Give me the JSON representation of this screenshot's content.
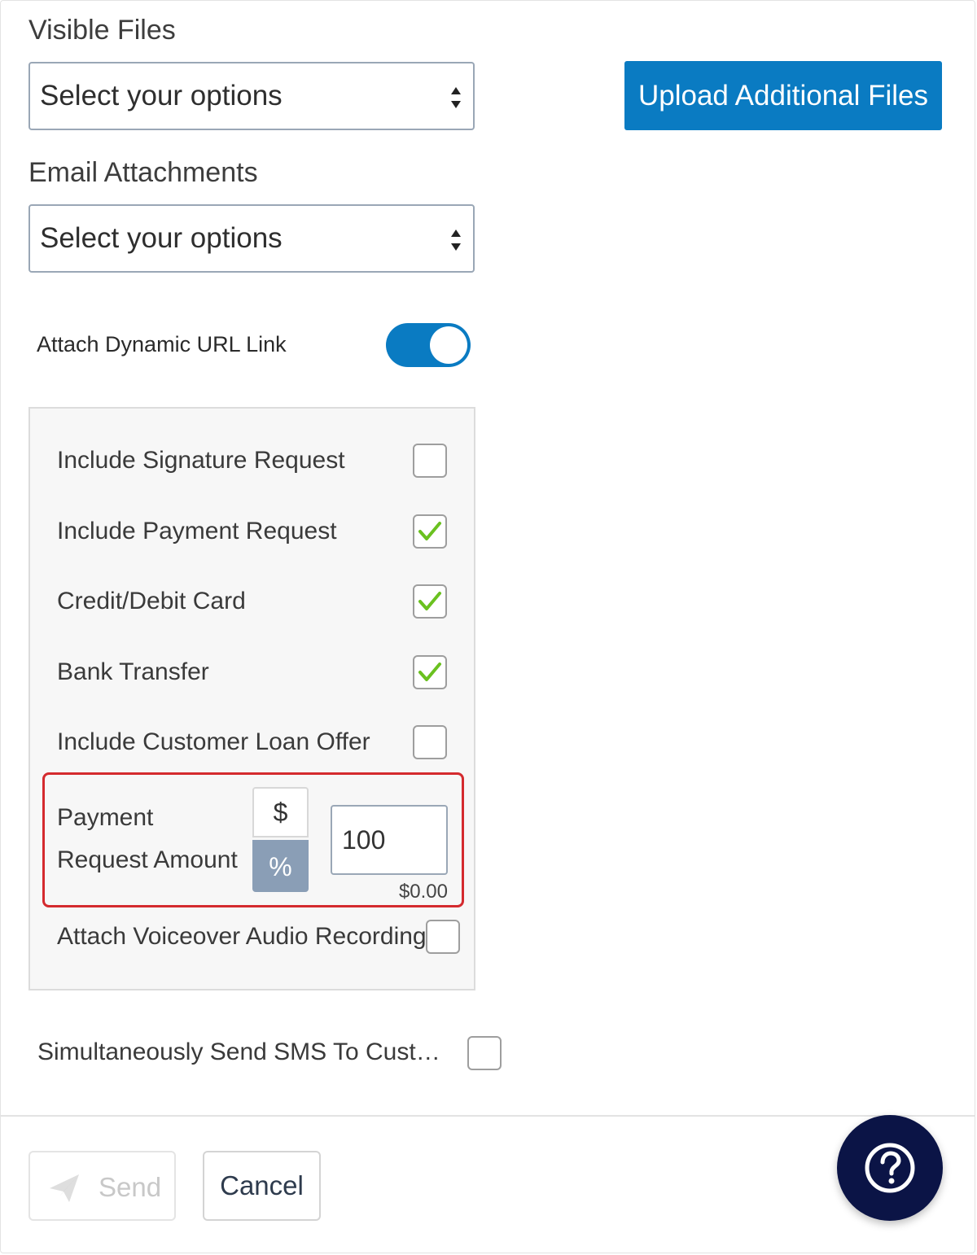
{
  "visible_files": {
    "label": "Visible Files",
    "placeholder": "Select your options"
  },
  "email_attachments": {
    "label": "Email Attachments",
    "placeholder": "Select your options"
  },
  "upload_button": {
    "label": "Upload Additional Files"
  },
  "dynamic_url": {
    "label": "Attach Dynamic URL Link",
    "enabled": true
  },
  "options": [
    {
      "label": "Include Signature Request",
      "checked": false
    },
    {
      "label": "Include Payment Request",
      "checked": true
    },
    {
      "label": "Credit/Debit Card",
      "checked": true
    },
    {
      "label": "Bank Transfer",
      "checked": true
    },
    {
      "label": "Include Customer Loan Offer",
      "checked": false
    }
  ],
  "payment_amount": {
    "label_line1": "Payment",
    "label_line2": "Request Amount",
    "unit_dollar": "$",
    "unit_percent": "%",
    "selected_unit": "%",
    "value": "100",
    "computed": "$0.00"
  },
  "voiceover": {
    "label": "Attach Voiceover Audio Recording",
    "checked": false
  },
  "sms": {
    "label": "Simultaneously Send SMS To Customer",
    "checked": false
  },
  "footer": {
    "send_label": "Send",
    "cancel_label": "Cancel"
  },
  "colors": {
    "accent": "#0a7bc2",
    "check_green": "#6ac11f",
    "highlight_red": "#d42a2e",
    "help_bg": "#0b1446"
  },
  "icons": {
    "select_arrows": "sort-icon",
    "send": "paper-plane-icon",
    "help": "question-circle-icon",
    "check": "checkmark-icon"
  }
}
